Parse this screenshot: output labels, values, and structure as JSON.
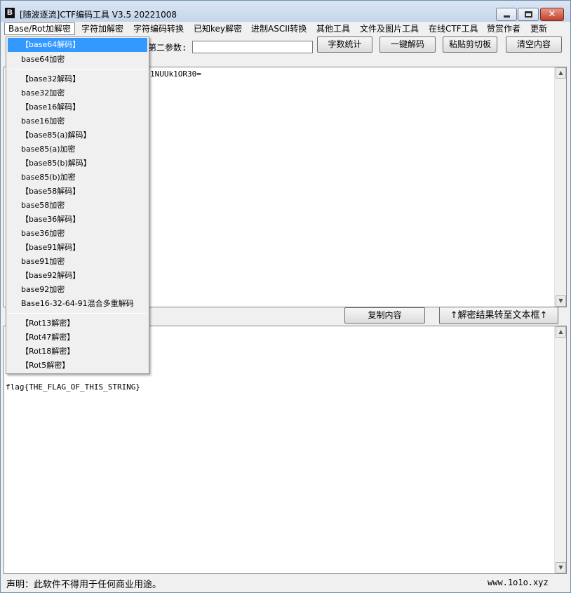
{
  "window": {
    "title": "[随波逐流]CTF编码工具 V3.5 20221008",
    "app_icon_glyph": "B"
  },
  "titlebar_buttons": {
    "minimize": "—",
    "maximize": "□",
    "close": "✕"
  },
  "menu": [
    "Base/Rot加解密",
    "字符加解密",
    "字符编码转换",
    "已知key解密",
    "进制ASCII转换",
    "其他工具",
    "文件及图片工具",
    "在线CTF工具",
    "赞赏作者",
    "更新"
  ],
  "toolbar": {
    "param_label": "第二参数:",
    "param_value": "",
    "btn_count": "字数统计",
    "btn_oneclick": "一键解码",
    "btn_paste": "粘贴剪切板",
    "btn_clear": "清空内容"
  },
  "input": {
    "visible_text": "1NUUk1OR30="
  },
  "mid": {
    "btn_copy": "复制内容",
    "btn_transfer": "↑解密结果转至文本框↑"
  },
  "output": {
    "text": "flag{THE_FLAG_OF_THIS_STRING}"
  },
  "dropdown": {
    "group1": [
      "【base64解码】",
      "base64加密"
    ],
    "group2": [
      "【base32解码】",
      "base32加密",
      "【base16解码】",
      "base16加密",
      "【base85(a)解码】",
      "base85(a)加密",
      "【base85(b)解码】",
      "base85(b)加密",
      "【base58解码】",
      "base58加密",
      "【base36解码】",
      "base36加密",
      "【base91解码】",
      "base91加密",
      "【base92解码】",
      "base92加密",
      "Base16-32-64-91混合多重解码"
    ],
    "group3": [
      "【Rot13解密】",
      "【Rot47解密】",
      "【Rot18解密】",
      "【Rot5解密】"
    ],
    "highlighted": "【base64解码】"
  },
  "status": {
    "left": "声明：此软件不得用于任何商业用途。",
    "right": "www.1o1o.xyz"
  },
  "colors": {
    "highlight": "#3399ff",
    "titlebar": "#c5d5ea",
    "close_button": "#c3402a"
  }
}
